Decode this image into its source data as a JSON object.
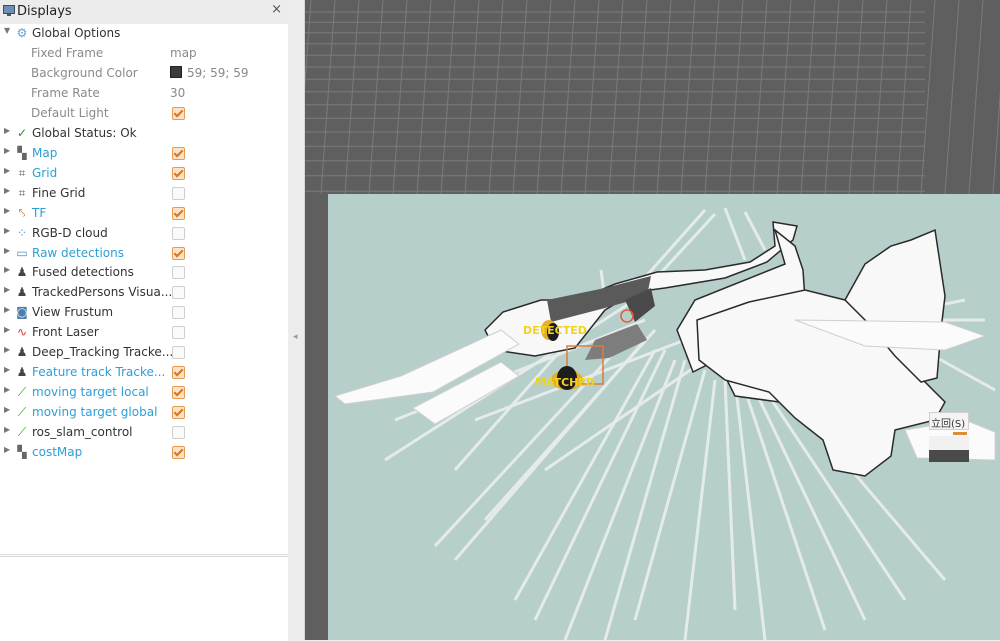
{
  "panel": {
    "title": "Displays",
    "close": "×",
    "global_options": {
      "label": "Global Options",
      "props": [
        {
          "label": "Fixed Frame",
          "value": "map"
        },
        {
          "label": "Background Color",
          "value": "59; 59; 59"
        },
        {
          "label": "Frame Rate",
          "value": "30"
        },
        {
          "label": "Default Light",
          "checked": true
        }
      ]
    },
    "status": {
      "label": "Global Status: Ok"
    },
    "displays": [
      {
        "label": "Map",
        "icon": "map-icon",
        "checked": true,
        "highlight": true
      },
      {
        "label": "Grid",
        "icon": "grid-icon",
        "checked": true,
        "highlight": true
      },
      {
        "label": "Fine Grid",
        "icon": "grid-icon",
        "checked": false,
        "highlight": false
      },
      {
        "label": "TF",
        "icon": "tf-icon",
        "checked": true,
        "highlight": true
      },
      {
        "label": "RGB-D cloud",
        "icon": "pointcloud-icon",
        "checked": false,
        "highlight": false
      },
      {
        "label": "Raw detections",
        "icon": "window-icon",
        "checked": true,
        "highlight": true
      },
      {
        "label": "Fused detections",
        "icon": "person-icon",
        "checked": false,
        "highlight": false
      },
      {
        "label": "TrackedPersons Visua...",
        "icon": "person-icon",
        "checked": false,
        "highlight": false
      },
      {
        "label": "View Frustum",
        "icon": "camera-icon",
        "checked": false,
        "highlight": false
      },
      {
        "label": "Front Laser",
        "icon": "laser-icon",
        "checked": false,
        "highlight": false
      },
      {
        "label": "Deep_Tracking Tracke...",
        "icon": "person-icon",
        "checked": false,
        "highlight": false
      },
      {
        "label": "Feature track Tracke...",
        "icon": "person-icon",
        "checked": true,
        "highlight": true
      },
      {
        "label": "moving target local",
        "icon": "path-icon",
        "checked": true,
        "highlight": true
      },
      {
        "label": "moving target global",
        "icon": "path-icon",
        "checked": true,
        "highlight": true
      },
      {
        "label": "ros_slam_control",
        "icon": "path-icon",
        "checked": false,
        "highlight": false
      },
      {
        "label": "costMap",
        "icon": "map-icon",
        "checked": true,
        "highlight": true
      }
    ]
  },
  "viewport": {
    "background_color": "#5e5e5e",
    "map_color": "#b7d0cd",
    "labels": {
      "detected": "DETECTED",
      "matched": "MATCHED"
    },
    "widget_label": "立回(S)"
  }
}
